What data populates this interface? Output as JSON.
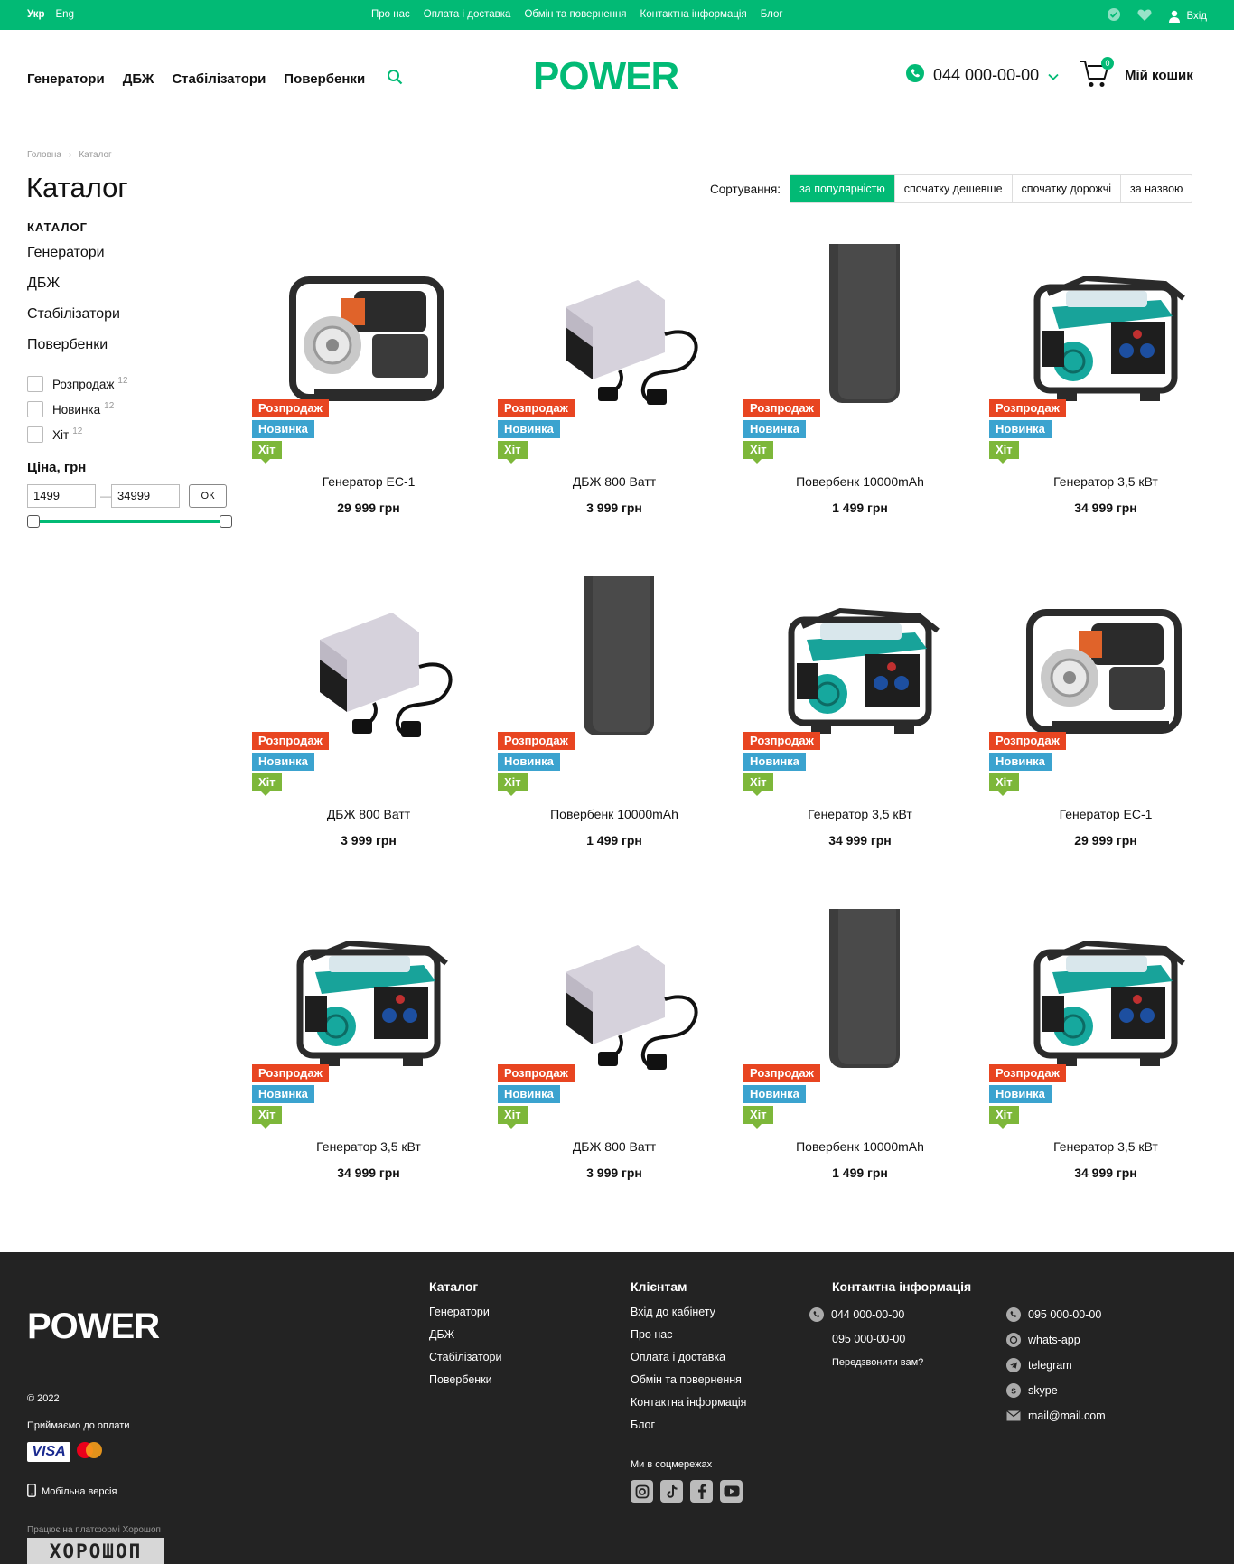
{
  "topbar": {
    "lang_active": "Укр",
    "lang_other": "Eng",
    "links": [
      "Про нас",
      "Оплата і доставка",
      "Обмін та повернення",
      "Контактна інформація",
      "Блог"
    ],
    "login": "Вхід"
  },
  "header": {
    "nav": [
      "Генератори",
      "ДБЖ",
      "Стабілізатори",
      "Повербенки"
    ],
    "logo": "POWER",
    "phone": "044 000-00-00",
    "cart_count": "0",
    "cart_label": "Мій кошик"
  },
  "breadcrumb": [
    "Головна",
    "Каталог"
  ],
  "page_title": "Каталог",
  "sort": {
    "label": "Сортування:",
    "options": [
      "за популярністю",
      "спочатку дешевше",
      "спочатку дорожчі",
      "за назвою"
    ],
    "active": "за популярністю"
  },
  "sidebar": {
    "heading": "КАТАЛОГ",
    "categories": [
      "Генератори",
      "ДБЖ",
      "Стабілізатори",
      "Повербенки"
    ],
    "filters": [
      {
        "label": "Розпродаж",
        "count": "12"
      },
      {
        "label": "Новинка",
        "count": "12"
      },
      {
        "label": "Хіт",
        "count": "12"
      }
    ],
    "price_heading": "Ціна, грн",
    "price_min": "1499",
    "price_max": "34999",
    "ok": "ОК",
    "range_fraction": [
      0,
      1
    ]
  },
  "badges": {
    "sale": "Розпродаж",
    "new": "Новинка",
    "hit": "Хіт"
  },
  "products": [
    {
      "name": "Генератор ЕС-1",
      "price": "29 999 грн",
      "image": "water-pump-icon"
    },
    {
      "name": "ДБЖ 800 Ватт",
      "price": "3 999 грн",
      "image": "ups-icon"
    },
    {
      "name": "Повербенк 10000mAh",
      "price": "1 499 грн",
      "image": "powerbank-icon"
    },
    {
      "name": "Генератор 3,5 кВт",
      "price": "34 999 грн",
      "image": "generator-icon"
    },
    {
      "name": "ДБЖ 800 Ватт",
      "price": "3 999 грн",
      "image": "ups-icon"
    },
    {
      "name": "Повербенк 10000mAh",
      "price": "1 499 грн",
      "image": "powerbank-icon"
    },
    {
      "name": "Генератор 3,5 кВт",
      "price": "34 999 грн",
      "image": "generator-icon"
    },
    {
      "name": "Генератор ЕС-1",
      "price": "29 999 грн",
      "image": "water-pump-icon"
    },
    {
      "name": "Генератор 3,5 кВт",
      "price": "34 999 грн",
      "image": "generator-icon"
    },
    {
      "name": "ДБЖ 800 Ватт",
      "price": "3 999 грн",
      "image": "ups-icon"
    },
    {
      "name": "Повербенк 10000mAh",
      "price": "1 499 грн",
      "image": "powerbank-icon"
    },
    {
      "name": "Генератор 3,5 кВт",
      "price": "34 999 грн",
      "image": "generator-icon"
    }
  ],
  "footer": {
    "logo": "POWER",
    "copyright": "© 2022",
    "payment_label": "Приймаємо до оплати",
    "visa": "VISA",
    "mobile": "Мобільна версія",
    "platform": "Працює на платформі Хорошоп",
    "platform_logo": "ХОРОШОП",
    "catalog_heading": "Каталог",
    "catalog_links": [
      "Генератори",
      "ДБЖ",
      "Стабілізатори",
      "Повербенки"
    ],
    "clients_heading": "Клієнтам",
    "clients_links": [
      "Вхід до кабінету",
      "Про нас",
      "Оплата і доставка",
      "Обмін та повернення",
      "Контактна інформація",
      "Блог"
    ],
    "social_label": "Ми в соцмережах",
    "contacts_heading": "Контактна інформація",
    "phone1": "044 000-00-00",
    "phone2": "095 000-00-00",
    "callback": "Передзвонити вам?",
    "viber": "095 000-00-00",
    "whatsapp": "whats-app",
    "telegram": "telegram",
    "skype": "skype",
    "email": "mail@mail.com"
  },
  "colors": {
    "accent": "#02ba75",
    "sale": "#e84521",
    "new": "#3ba3cf",
    "hit": "#7db73a",
    "footer_bg": "#232323"
  }
}
